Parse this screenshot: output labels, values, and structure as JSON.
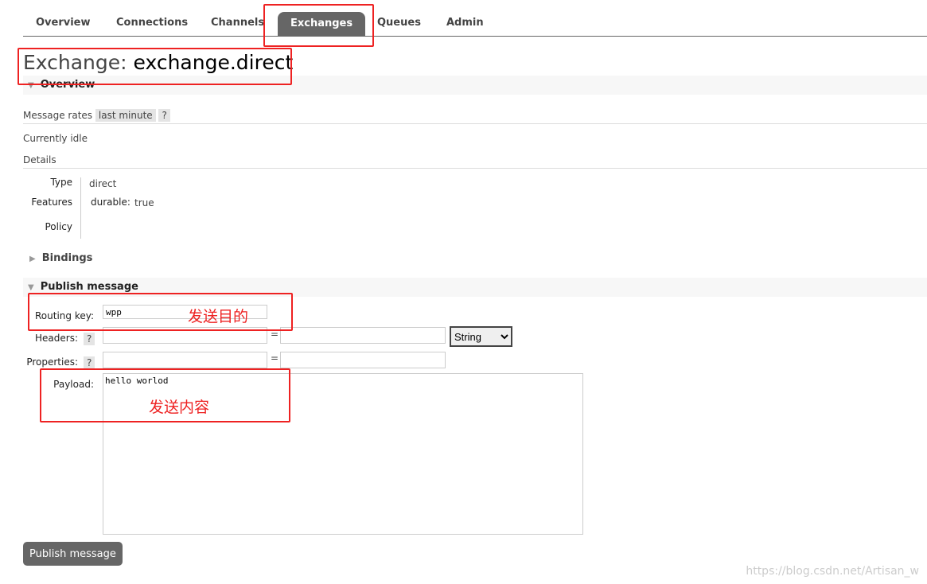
{
  "nav": {
    "tabs": [
      {
        "label": "Overview"
      },
      {
        "label": "Connections"
      },
      {
        "label": "Channels"
      },
      {
        "label": "Exchanges",
        "active": true
      },
      {
        "label": "Queues"
      },
      {
        "label": "Admin"
      }
    ]
  },
  "page": {
    "title_prefix": "Exchange:",
    "title_name": "exchange.direct"
  },
  "overview": {
    "header": "Overview",
    "rates_label": "Message rates",
    "rates_period": "last minute",
    "help": "?",
    "idle": "Currently idle",
    "details": "Details",
    "type_label": "Type",
    "type_value": "direct",
    "features_label": "Features",
    "features_key": "durable:",
    "features_value": "true",
    "policy_label": "Policy"
  },
  "bindings": {
    "header": "Bindings"
  },
  "publish": {
    "header": "Publish message",
    "routing_key_label": "Routing key:",
    "routing_key": "wpp",
    "headers_label": "Headers:",
    "properties_label": "Properties:",
    "help": "?",
    "eq": "=",
    "type_select": "String",
    "payload_label": "Payload:",
    "payload": "hello worlod",
    "button": "Publish message"
  },
  "annotations": {
    "routing_note": "发送目的",
    "payload_note": "发送内容",
    "color": "#ee2222"
  },
  "watermark": "https://blog.csdn.net/Artisan_w"
}
